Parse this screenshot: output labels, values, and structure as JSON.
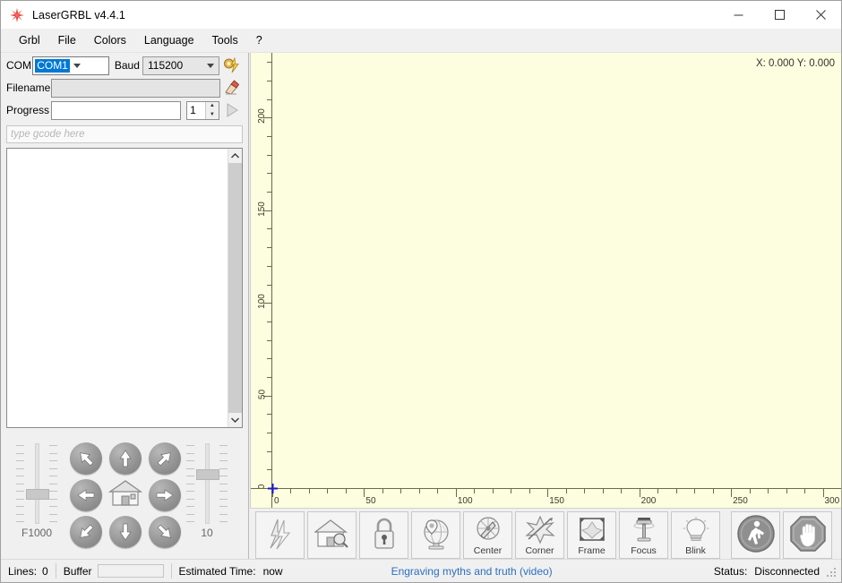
{
  "window": {
    "title": "LaserGRBL v4.4.1",
    "icon": "lasergrbl-star-icon",
    "minimize": "─",
    "maximize": "☐",
    "close": "✕"
  },
  "menubar": {
    "items": [
      {
        "label": "Grbl",
        "name": "menu-grbl"
      },
      {
        "label": "File",
        "name": "menu-file"
      },
      {
        "label": "Colors",
        "name": "menu-colors"
      },
      {
        "label": "Language",
        "name": "menu-language"
      },
      {
        "label": "Tools",
        "name": "menu-tools"
      },
      {
        "label": "?",
        "name": "menu-help"
      }
    ]
  },
  "connection": {
    "com_label": "COM",
    "com_value": "COM1",
    "baud_label": "Baud",
    "baud_value": "115200",
    "connect_icon": "connect-plug-icon"
  },
  "file": {
    "filename_label": "Filename",
    "filename_value": "",
    "filename_placeholder": "",
    "erase_icon": "eraser-icon"
  },
  "progress": {
    "label": "Progress",
    "value": "",
    "repeat_count": "1",
    "spin_up": "▲",
    "spin_down": "▼",
    "run_icon": "play-triangle-icon"
  },
  "gcode_entry": {
    "placeholder": "type gcode here",
    "value": ""
  },
  "gcode_list": {
    "rows": [],
    "scroll_up_icon": "chevron-up-icon",
    "scroll_down_icon": "chevron-down-icon"
  },
  "jog": {
    "feed_slider_label": "F1000",
    "step_slider_label": "10",
    "buttons": [
      {
        "name": "jog-up-left",
        "dir": "up-left"
      },
      {
        "name": "jog-up",
        "dir": "up"
      },
      {
        "name": "jog-up-right",
        "dir": "up-right"
      },
      {
        "name": "jog-left",
        "dir": "left"
      },
      {
        "name": "jog-home",
        "dir": "home"
      },
      {
        "name": "jog-right",
        "dir": "right"
      },
      {
        "name": "jog-down-left",
        "dir": "down-left"
      },
      {
        "name": "jog-down",
        "dir": "down"
      },
      {
        "name": "jog-down-right",
        "dir": "down-right"
      }
    ]
  },
  "canvas": {
    "coordinate_readout": "X: 0.000 Y: 0.000",
    "background_color": "#fdfddf",
    "origin_marker_color": "#1a1ad0",
    "ruler": {
      "x_labels": [
        "0",
        "50",
        "100",
        "150",
        "200",
        "250",
        "300"
      ],
      "x_values": [
        0,
        50,
        100,
        150,
        200,
        250,
        300
      ],
      "x_min": 0,
      "x_max": 310,
      "y_labels": [
        "0",
        "50",
        "100",
        "150",
        "200"
      ],
      "y_values": [
        0,
        50,
        100,
        150,
        200
      ],
      "y_min": 0,
      "y_max": 235,
      "minor_step": 10
    }
  },
  "toolbar": {
    "buttons": [
      {
        "name": "connect-laser-button",
        "label": "",
        "icon": "lightning-bolt-icon"
      },
      {
        "name": "home-button",
        "label": "",
        "icon": "home-search-icon"
      },
      {
        "name": "unlock-button",
        "label": "",
        "icon": "padlock-icon"
      },
      {
        "name": "set-zero-button",
        "label": "",
        "icon": "globe-pin-icon"
      },
      {
        "name": "center-button",
        "label": "Center",
        "icon": "crosshair-compass-icon"
      },
      {
        "name": "corner-button",
        "label": "Corner",
        "icon": "corner-star-icon"
      },
      {
        "name": "frame-button",
        "label": "Frame",
        "icon": "frame-arrows-icon"
      },
      {
        "name": "focus-button",
        "label": "Focus",
        "icon": "focus-lamp-icon"
      },
      {
        "name": "blink-button",
        "label": "Blink",
        "icon": "lightbulb-icon"
      }
    ],
    "right_buttons": [
      {
        "name": "run-program-button",
        "icon": "walking-man-icon"
      },
      {
        "name": "stop-program-button",
        "icon": "stop-hand-icon"
      }
    ]
  },
  "statusbar": {
    "lines_label": "Lines:",
    "lines_value": "0",
    "buffer_label": "Buffer",
    "buffer_percent": 0,
    "estimated_time_label": "Estimated Time:",
    "estimated_time_value": "now",
    "link_text": "Engraving myths and truth (video)",
    "status_label": "Status:",
    "status_value": "Disconnected",
    "link_color": "#2b6fbe"
  }
}
